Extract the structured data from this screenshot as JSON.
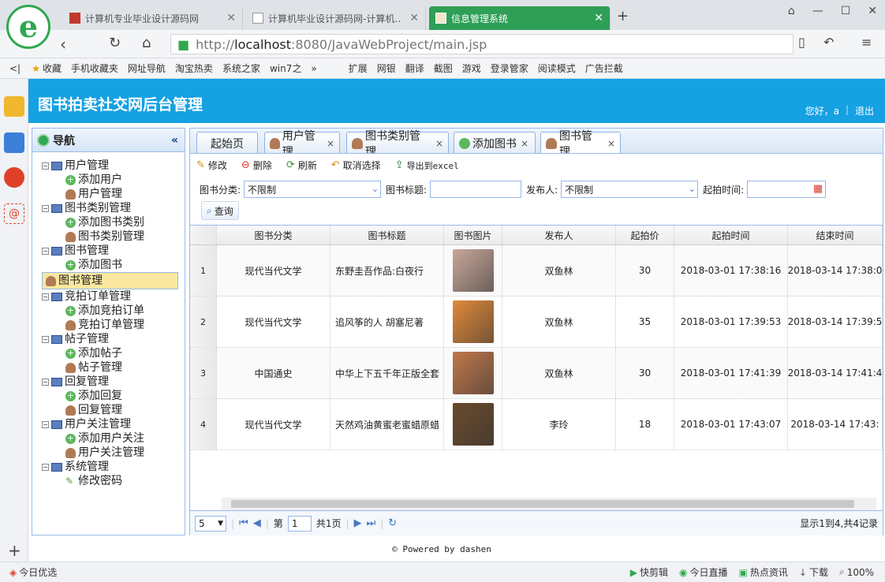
{
  "browser": {
    "tabs": [
      {
        "label": "计算机专业毕业设计源码网",
        "active": false
      },
      {
        "label": "计算机毕业设计源码网-计算机…",
        "active": false
      },
      {
        "label": "信息管理系统",
        "active": true
      }
    ],
    "url_prefix": "http://",
    "url_host": "localhost",
    "url_rest": ":8080/JavaWebProject/main.jsp",
    "bookmarks": [
      "收藏",
      "手机收藏夹",
      "网址导航",
      "淘宝热卖",
      "系统之家",
      "win7之",
      "扩展",
      "网银",
      "翻译",
      "截图",
      "游戏",
      "登录管家",
      "阅读模式",
      "广告拦截"
    ]
  },
  "app": {
    "title": "图书拍卖社交网后台管理",
    "greeting": "您好，a",
    "logout": "退出"
  },
  "nav": {
    "title": "导航",
    "groups": [
      {
        "label": "用户管理",
        "items": [
          {
            "label": "添加用户",
            "icon": "add"
          },
          {
            "label": "用户管理",
            "icon": "user"
          }
        ]
      },
      {
        "label": "图书类别管理",
        "items": [
          {
            "label": "添加图书类别",
            "icon": "add"
          },
          {
            "label": "图书类别管理",
            "icon": "user"
          }
        ]
      },
      {
        "label": "图书管理",
        "items": [
          {
            "label": "添加图书",
            "icon": "add"
          },
          {
            "label": "图书管理",
            "icon": "user",
            "selected": true
          }
        ]
      },
      {
        "label": "竞拍订单管理",
        "items": [
          {
            "label": "添加竞拍订单",
            "icon": "add"
          },
          {
            "label": "竞拍订单管理",
            "icon": "user"
          }
        ]
      },
      {
        "label": "帖子管理",
        "items": [
          {
            "label": "添加帖子",
            "icon": "add"
          },
          {
            "label": "帖子管理",
            "icon": "user"
          }
        ]
      },
      {
        "label": "回复管理",
        "items": [
          {
            "label": "添加回复",
            "icon": "add"
          },
          {
            "label": "回复管理",
            "icon": "user"
          }
        ]
      },
      {
        "label": "用户关注管理",
        "items": [
          {
            "label": "添加用户关注",
            "icon": "add"
          },
          {
            "label": "用户关注管理",
            "icon": "user"
          }
        ]
      },
      {
        "label": "系统管理",
        "items": [
          {
            "label": "修改密码",
            "icon": "pen"
          }
        ]
      }
    ]
  },
  "content_tabs": [
    {
      "label": "起始页",
      "closable": false,
      "icon": "none"
    },
    {
      "label": "用户管理",
      "closable": true,
      "icon": "user"
    },
    {
      "label": "图书类别管理",
      "closable": true,
      "icon": "user"
    },
    {
      "label": "添加图书",
      "closable": true,
      "icon": "add"
    },
    {
      "label": "图书管理",
      "closable": true,
      "icon": "user",
      "active": true
    }
  ],
  "toolbar": {
    "edit": "修改",
    "delete": "删除",
    "refresh": "刷新",
    "deselect": "取消选择",
    "export": "导出到excel"
  },
  "search": {
    "category_label": "图书分类:",
    "category_value": "不限制",
    "title_label": "图书标题:",
    "title_value": "",
    "publisher_label": "发布人:",
    "publisher_value": "不限制",
    "start_label": "起拍时间:",
    "start_value": "",
    "query": "查询"
  },
  "grid": {
    "columns": [
      "图书分类",
      "图书标题",
      "图书图片",
      "发布人",
      "起拍价",
      "起拍时间",
      "结束时间"
    ],
    "rows": [
      {
        "no": "1",
        "category": "现代当代文学",
        "title": "东野圭吾作品:白夜行",
        "publisher": "双鱼林",
        "price": "30",
        "start": "2018-03-01 17:38:16",
        "end": "2018-03-14 17:38:0",
        "cover_color": "#c9a79a"
      },
      {
        "no": "2",
        "category": "现代当代文学",
        "title": "追风筝的人 胡塞尼著",
        "publisher": "双鱼林",
        "price": "35",
        "start": "2018-03-01 17:39:53",
        "end": "2018-03-14 17:39:5",
        "cover_color": "#e08a3a"
      },
      {
        "no": "3",
        "category": "中国通史",
        "title": "中华上下五千年正版全套",
        "publisher": "双鱼林",
        "price": "30",
        "start": "2018-03-01 17:41:39",
        "end": "2018-03-14 17:41:4",
        "cover_color": "#c0784a"
      },
      {
        "no": "4",
        "category": "现代当代文学",
        "title": "天然鸡油黄蜜老蜜蜡原蜡",
        "publisher": "李玲",
        "price": "18",
        "start": "2018-03-01 17:43:07",
        "end": "2018-03-14 17:43:",
        "cover_color": "#6a4a2a"
      }
    ]
  },
  "pager": {
    "page_size": "5",
    "page_label": "第",
    "page_value": "1",
    "total_pages": "共1页",
    "info": "显示1到4,共4记录"
  },
  "footer": "Powered by dashen",
  "statusbar": [
    "今日优选",
    "快剪辑",
    "今日直播",
    "热点资讯",
    "下载",
    "100%"
  ],
  "colors": {
    "header": "#15a1e2",
    "browser_accent": "#2f9e57",
    "selected": "#fbe8a0"
  }
}
